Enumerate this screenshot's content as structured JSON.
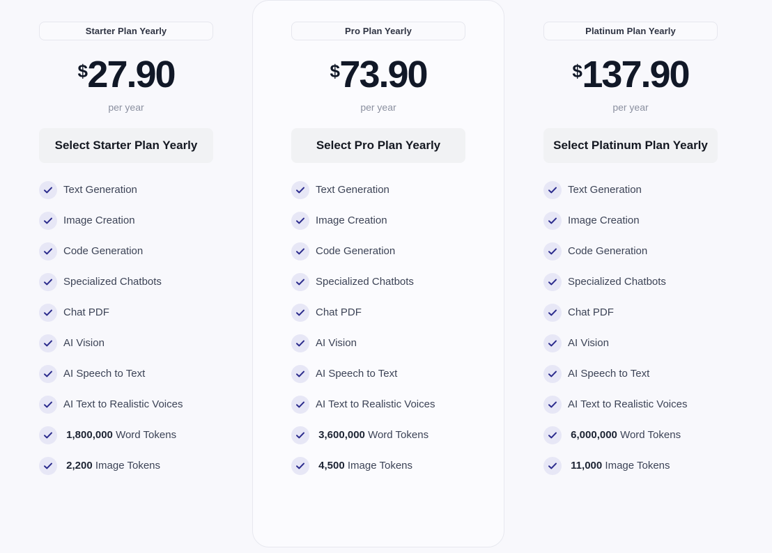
{
  "page": {
    "background_color": "#f8f8fc",
    "accent_color": "#2a2a8c",
    "check_bg_color": "#e7e7f6"
  },
  "plans": [
    {
      "id": "starter",
      "name": "Starter Plan Yearly",
      "currency": "$",
      "amount": "27.90",
      "period": "per year",
      "cta": "Select Starter Plan Yearly",
      "featured": false,
      "features": [
        "Text Generation",
        "Image Creation",
        "Code Generation",
        "Specialized Chatbots",
        "Chat PDF",
        "AI Vision",
        "AI Speech to Text",
        "AI Text to Realistic Voices"
      ],
      "word_tokens_value": "1,800,000",
      "word_tokens_label": "Word Tokens",
      "image_tokens_value": "2,200",
      "image_tokens_label": "Image Tokens"
    },
    {
      "id": "pro",
      "name": "Pro Plan Yearly",
      "currency": "$",
      "amount": "73.90",
      "period": "per year",
      "cta": "Select Pro Plan Yearly",
      "featured": true,
      "features": [
        "Text Generation",
        "Image Creation",
        "Code Generation",
        "Specialized Chatbots",
        "Chat PDF",
        "AI Vision",
        "AI Speech to Text",
        "AI Text to Realistic Voices"
      ],
      "word_tokens_value": "3,600,000",
      "word_tokens_label": "Word Tokens",
      "image_tokens_value": "4,500",
      "image_tokens_label": "Image Tokens"
    },
    {
      "id": "platinum",
      "name": "Platinum Plan Yearly",
      "currency": "$",
      "amount": "137.90",
      "period": "per year",
      "cta": "Select Platinum Plan Yearly",
      "featured": false,
      "features": [
        "Text Generation",
        "Image Creation",
        "Code Generation",
        "Specialized Chatbots",
        "Chat PDF",
        "AI Vision",
        "AI Speech to Text",
        "AI Text to Realistic Voices"
      ],
      "word_tokens_value": "6,000,000",
      "word_tokens_label": "Word Tokens",
      "image_tokens_value": "11,000",
      "image_tokens_label": "Image Tokens"
    }
  ]
}
